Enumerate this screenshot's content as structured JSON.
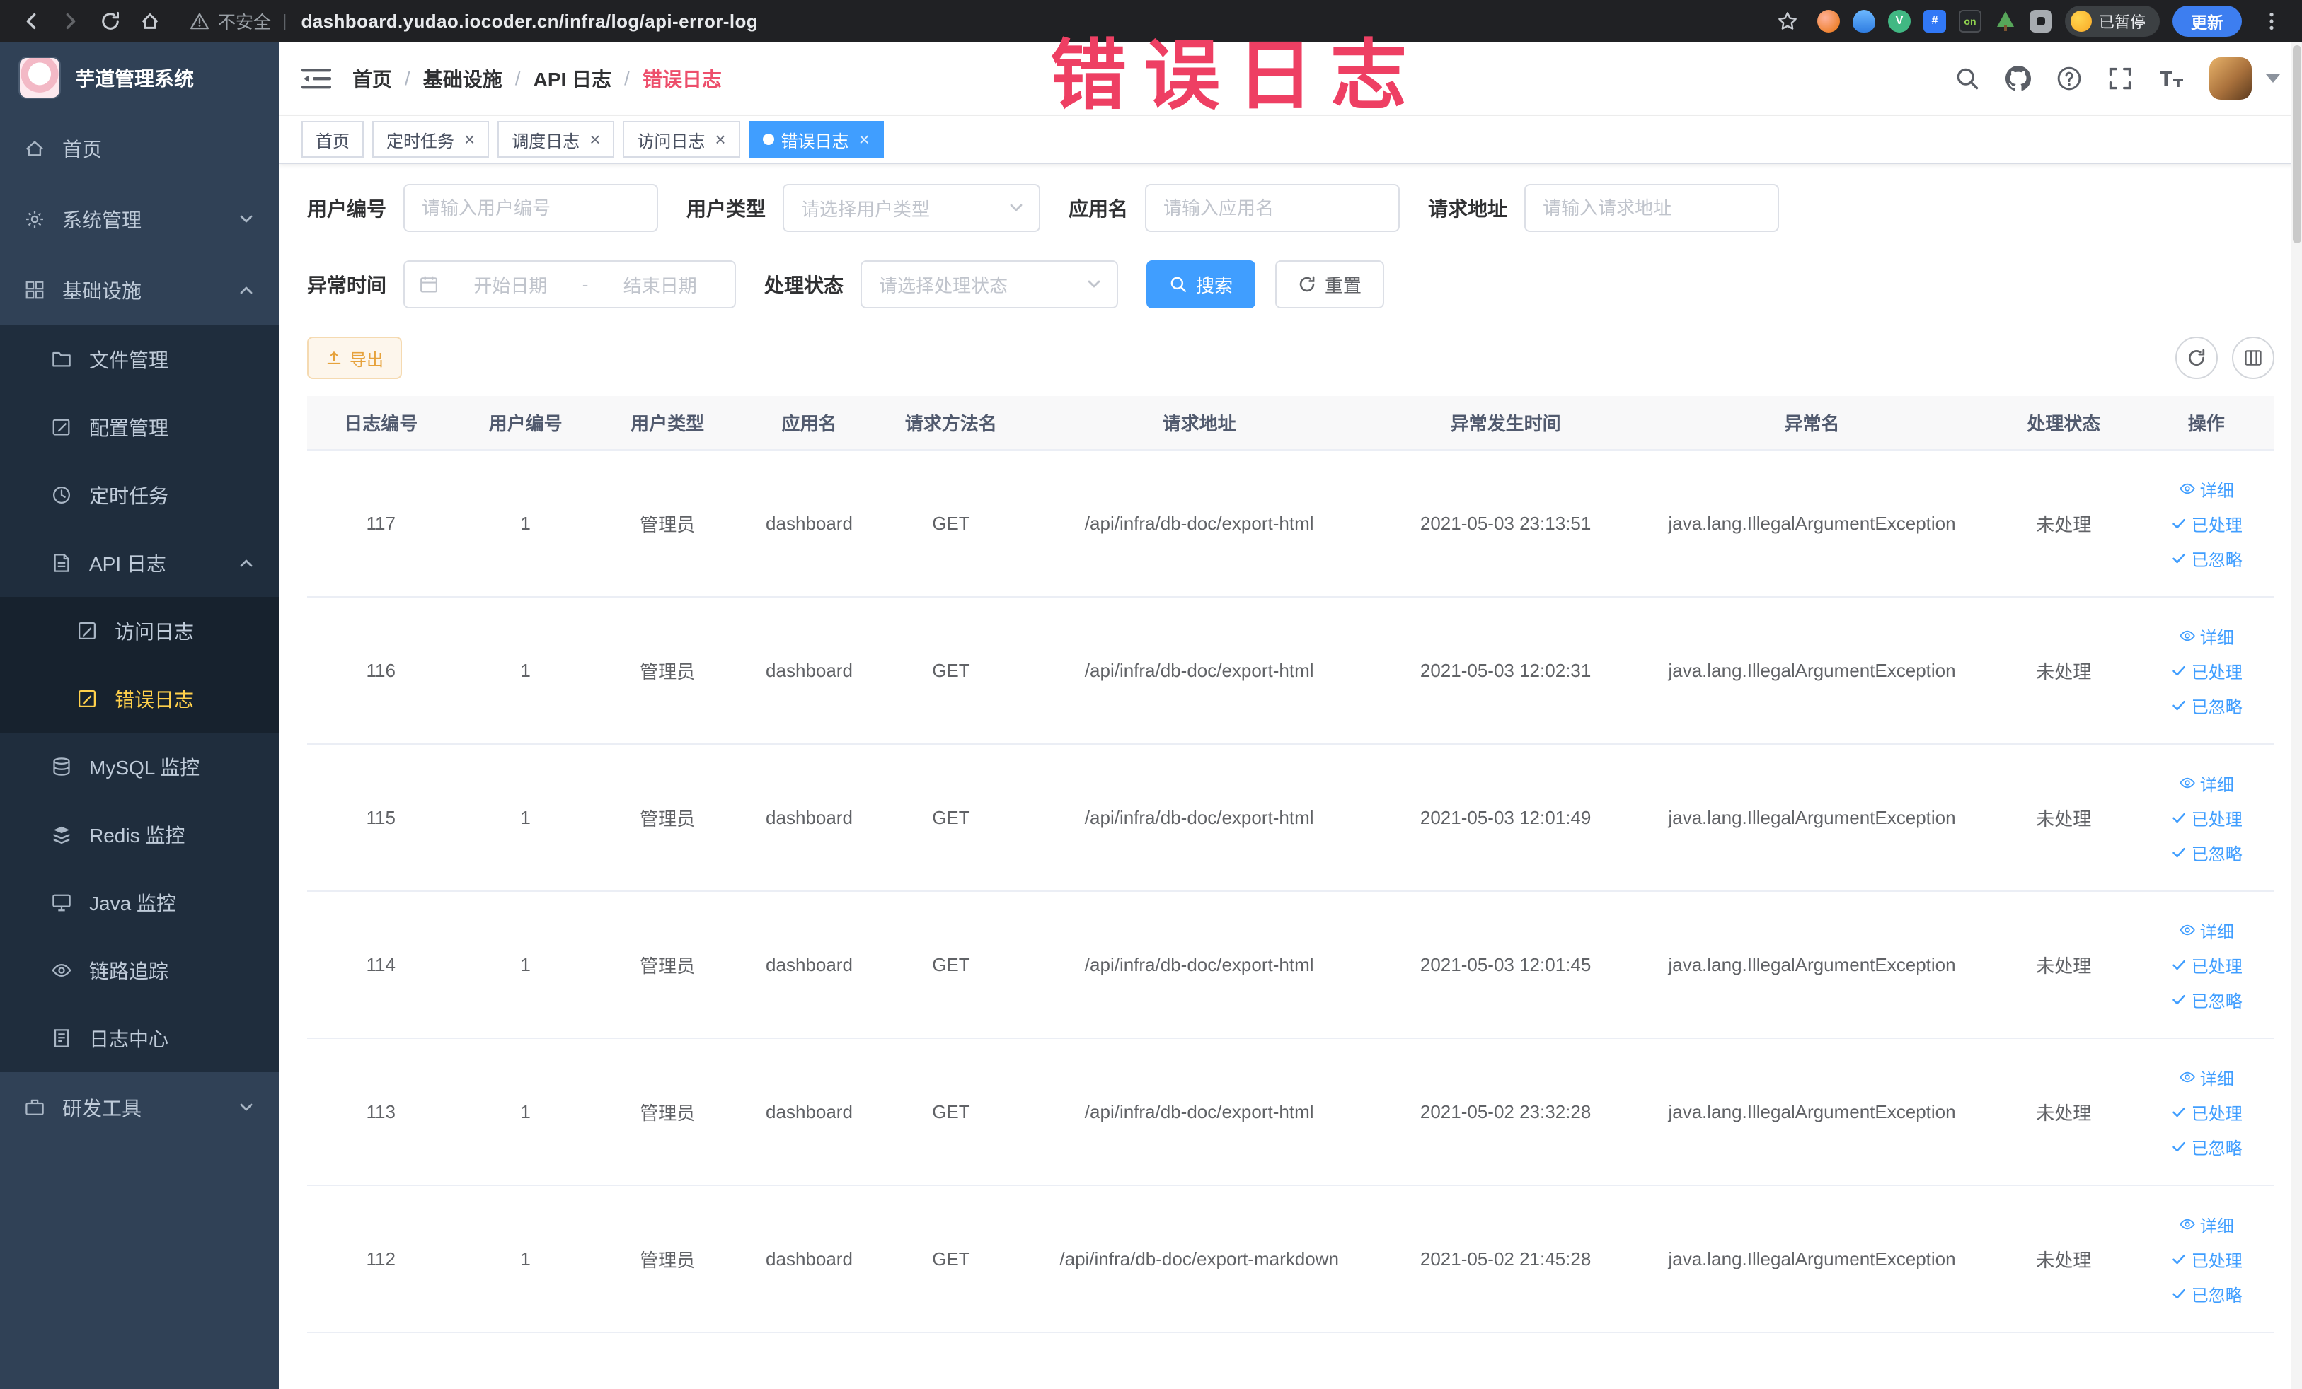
{
  "browser": {
    "security_label": "不安全",
    "url_separator": "|",
    "url": "dashboard.yudao.iocoder.cn/infra/log/api-error-log",
    "paused_badge": "已暂停",
    "update_button": "更新",
    "nav_buttons": [
      {
        "name": "back",
        "icon": "arrow-left"
      },
      {
        "name": "forward",
        "icon": "arrow-right"
      },
      {
        "name": "refresh",
        "icon": "refresh"
      },
      {
        "name": "home",
        "icon": "home-chrome"
      }
    ],
    "extensions": [
      {
        "name": "extension-orange",
        "style": "orange",
        "text": ""
      },
      {
        "name": "extension-drop",
        "style": "drop",
        "text": ""
      },
      {
        "name": "extension-vue",
        "style": "vue",
        "text": "V"
      },
      {
        "name": "extension-grid",
        "style": "grid",
        "text": "#"
      },
      {
        "name": "extension-on",
        "style": "on",
        "text": "on"
      },
      {
        "name": "extension-octotree",
        "style": "tree",
        "text": ""
      },
      {
        "name": "extensions-puzzle",
        "style": "puzzle",
        "text": ""
      }
    ]
  },
  "watermark": "错误日志",
  "sidebar": {
    "logo_title": "芋道管理系统",
    "items": [
      {
        "label": "首页",
        "icon": "m-home",
        "level": 1
      },
      {
        "label": "系统管理",
        "icon": "m-gear",
        "level": 1,
        "chevron": "down"
      },
      {
        "label": "基础设施",
        "icon": "m-grid",
        "level": 1,
        "chevron": "up"
      },
      {
        "label": "文件管理",
        "icon": "m-folder",
        "level": 2
      },
      {
        "label": "配置管理",
        "icon": "m-edit",
        "level": 2
      },
      {
        "label": "定时任务",
        "icon": "m-clock",
        "level": 2
      },
      {
        "label": "API 日志",
        "icon": "m-apidoc",
        "level": 2,
        "chevron": "up"
      },
      {
        "label": "访问日志",
        "icon": "m-doc",
        "level": 3
      },
      {
        "label": "错误日志",
        "icon": "m-doc",
        "level": 3,
        "active": true
      },
      {
        "label": "MySQL 监控",
        "icon": "m-db",
        "level": 2
      },
      {
        "label": "Redis 监控",
        "icon": "m-redis",
        "level": 2
      },
      {
        "label": "Java 监控",
        "icon": "m-monitor",
        "level": 2
      },
      {
        "label": "链路追踪",
        "icon": "eye",
        "level": 2
      },
      {
        "label": "日志中心",
        "icon": "m-docs",
        "level": 2
      },
      {
        "label": "研发工具",
        "icon": "m-tools",
        "level": 1,
        "chevron": "down"
      }
    ]
  },
  "navbar": {
    "breadcrumb": [
      "首页",
      "基础设施",
      "API 日志",
      "错误日志"
    ],
    "breadcrumb_separator": "/",
    "action_icons": [
      {
        "name": "search",
        "icon": "search"
      },
      {
        "name": "github",
        "icon": "github"
      },
      {
        "name": "help-question",
        "icon": "question"
      },
      {
        "name": "fullscreen",
        "icon": "fullscreen"
      },
      {
        "name": "font-size",
        "icon": "fontsize"
      }
    ]
  },
  "tags": [
    {
      "label": "首页",
      "closable": false,
      "active": false
    },
    {
      "label": "定时任务",
      "closable": true,
      "active": false
    },
    {
      "label": "调度日志",
      "closable": true,
      "active": false
    },
    {
      "label": "访问日志",
      "closable": true,
      "active": false
    },
    {
      "label": "错误日志",
      "closable": true,
      "active": true
    }
  ],
  "filters": {
    "user_id": {
      "label": "用户编号",
      "placeholder": "请输入用户编号"
    },
    "user_type": {
      "label": "用户类型",
      "placeholder": "请选择用户类型"
    },
    "app_name": {
      "label": "应用名",
      "placeholder": "请输入应用名"
    },
    "request_url": {
      "label": "请求地址",
      "placeholder": "请输入请求地址"
    },
    "exception_time": {
      "label": "异常时间",
      "start_placeholder": "开始日期",
      "separator": "-",
      "end_placeholder": "结束日期"
    },
    "process_status": {
      "label": "处理状态",
      "placeholder": "请选择处理状态"
    },
    "search_button": "搜索",
    "reset_button": "重置"
  },
  "toolbar": {
    "export_button": "导出"
  },
  "table": {
    "columns": [
      "日志编号",
      "用户编号",
      "用户类型",
      "应用名",
      "请求方法名",
      "请求地址",
      "异常发生时间",
      "异常名",
      "处理状态",
      "操作"
    ],
    "action_labels": [
      "详细",
      "已处理",
      "已忽略"
    ],
    "rows": [
      {
        "id": "117",
        "user_id": "1",
        "user_type": "管理员",
        "app": "dashboard",
        "method": "GET",
        "url": "/api/infra/db-doc/export-html",
        "time": "2021-05-03 23:13:51",
        "exception": "java.lang.IllegalArgumentException",
        "status": "未处理"
      },
      {
        "id": "116",
        "user_id": "1",
        "user_type": "管理员",
        "app": "dashboard",
        "method": "GET",
        "url": "/api/infra/db-doc/export-html",
        "time": "2021-05-03 12:02:31",
        "exception": "java.lang.IllegalArgumentException",
        "status": "未处理"
      },
      {
        "id": "115",
        "user_id": "1",
        "user_type": "管理员",
        "app": "dashboard",
        "method": "GET",
        "url": "/api/infra/db-doc/export-html",
        "time": "2021-05-03 12:01:49",
        "exception": "java.lang.IllegalArgumentException",
        "status": "未处理"
      },
      {
        "id": "114",
        "user_id": "1",
        "user_type": "管理员",
        "app": "dashboard",
        "method": "GET",
        "url": "/api/infra/db-doc/export-html",
        "time": "2021-05-03 12:01:45",
        "exception": "java.lang.IllegalArgumentException",
        "status": "未处理"
      },
      {
        "id": "113",
        "user_id": "1",
        "user_type": "管理员",
        "app": "dashboard",
        "method": "GET",
        "url": "/api/infra/db-doc/export-html",
        "time": "2021-05-02 23:32:28",
        "exception": "java.lang.IllegalArgumentException",
        "status": "未处理"
      },
      {
        "id": "112",
        "user_id": "1",
        "user_type": "管理员",
        "app": "dashboard",
        "method": "GET",
        "url": "/api/infra/db-doc/export-markdown",
        "time": "2021-05-02 21:45:28",
        "exception": "java.lang.IllegalArgumentException",
        "status": "未处理"
      }
    ]
  }
}
